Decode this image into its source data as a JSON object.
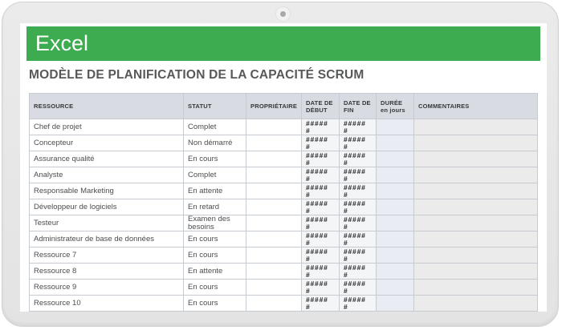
{
  "device": {
    "type": "tablet-mockup",
    "camera": "camera-dot"
  },
  "app_header": {
    "brand": "Excel",
    "background_color": "#3dab4f",
    "text_color": "#ffffff"
  },
  "page": {
    "title": "MODÈLE DE PLANIFICATION DE LA CAPACITÉ SCRUM",
    "title_color": "#57585a"
  },
  "table": {
    "header_background": "#d8dbe1",
    "columns": [
      {
        "key": "ressource",
        "label": "RESSOURCE"
      },
      {
        "key": "statut",
        "label": "STATUT"
      },
      {
        "key": "proprietaire",
        "label": "PROPRIÉTAIRE"
      },
      {
        "key": "date_debut",
        "label": "DATE DE DÉBUT"
      },
      {
        "key": "date_fin",
        "label": "DATE DE FIN"
      },
      {
        "key": "duree",
        "label": "DURÉE en jours"
      },
      {
        "key": "commentaires",
        "label": "COMMENTAIRES"
      }
    ],
    "rows": [
      {
        "ressource": "Chef de projet",
        "statut": "Complet",
        "proprietaire": "",
        "date_debut": "######",
        "date_fin": "######",
        "duree": "",
        "commentaires": ""
      },
      {
        "ressource": "Concepteur",
        "statut": "Non démarré",
        "proprietaire": "",
        "date_debut": "######",
        "date_fin": "######",
        "duree": "",
        "commentaires": ""
      },
      {
        "ressource": "Assurance qualité",
        "statut": "En cours",
        "proprietaire": "",
        "date_debut": "######",
        "date_fin": "######",
        "duree": "",
        "commentaires": ""
      },
      {
        "ressource": "Analyste",
        "statut": "Complet",
        "proprietaire": "",
        "date_debut": "######",
        "date_fin": "######",
        "duree": "",
        "commentaires": ""
      },
      {
        "ressource": "Responsable Marketing",
        "statut": "En attente",
        "proprietaire": "",
        "date_debut": "######",
        "date_fin": "######",
        "duree": "",
        "commentaires": ""
      },
      {
        "ressource": "Développeur de logiciels",
        "statut": "En retard",
        "proprietaire": "",
        "date_debut": "######",
        "date_fin": "######",
        "duree": "",
        "commentaires": ""
      },
      {
        "ressource": "Testeur",
        "statut": "Examen des besoins",
        "proprietaire": "",
        "date_debut": "######",
        "date_fin": "######",
        "duree": "",
        "commentaires": ""
      },
      {
        "ressource": "Administrateur de base de données",
        "statut": "En cours",
        "proprietaire": "",
        "date_debut": "######",
        "date_fin": "######",
        "duree": "",
        "commentaires": ""
      },
      {
        "ressource": "Ressource 7",
        "statut": "En cours",
        "proprietaire": "",
        "date_debut": "######",
        "date_fin": "######",
        "duree": "",
        "commentaires": ""
      },
      {
        "ressource": "Ressource 8",
        "statut": "En attente",
        "proprietaire": "",
        "date_debut": "######",
        "date_fin": "######",
        "duree": "",
        "commentaires": ""
      },
      {
        "ressource": "Ressource 9",
        "statut": "En cours",
        "proprietaire": "",
        "date_debut": "######",
        "date_fin": "######",
        "duree": "",
        "commentaires": ""
      },
      {
        "ressource": "Ressource 10",
        "statut": "En cours",
        "proprietaire": "",
        "date_debut": "######",
        "date_fin": "######",
        "duree": "",
        "commentaires": ""
      }
    ]
  }
}
